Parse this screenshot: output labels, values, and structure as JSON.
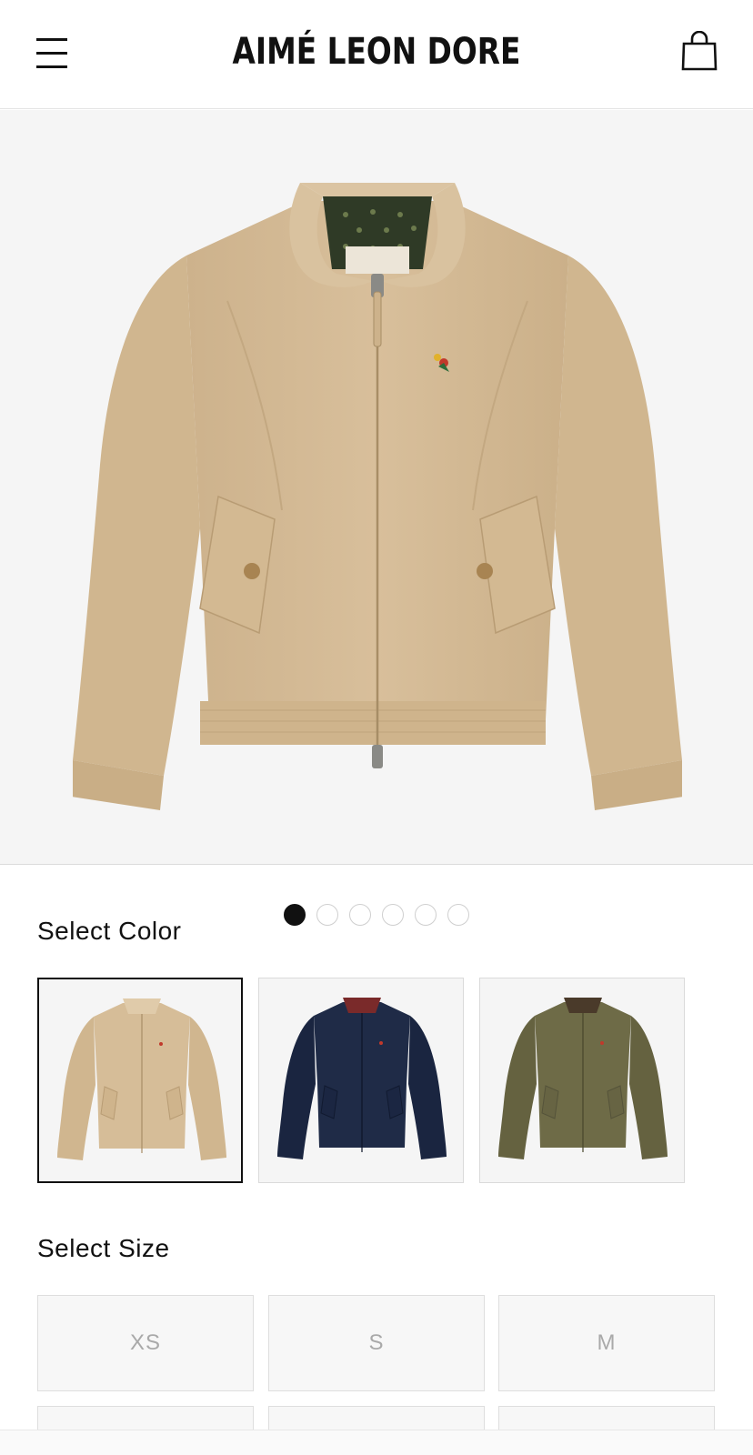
{
  "header": {
    "brand": "AIMÉ LEON DORE",
    "menu_icon": "hamburger-menu-icon",
    "cart_icon": "shopping-bag-icon"
  },
  "hero": {
    "image": "tan-harrington-jacket",
    "image_count": 6,
    "active_index": 0
  },
  "colors": {
    "label": "Select Color",
    "options": [
      {
        "name": "tan",
        "hex": "#d2b893",
        "selected": true
      },
      {
        "name": "navy",
        "hex": "#1e2a44",
        "selected": false
      },
      {
        "name": "olive",
        "hex": "#6b6845",
        "selected": false
      }
    ]
  },
  "sizes": {
    "label": "Select Size",
    "options": [
      "XS",
      "S",
      "M"
    ]
  },
  "theme": {
    "text": "#111111",
    "bg_image": "#f5f5f5",
    "muted_size_text": "#a9a9a9"
  }
}
